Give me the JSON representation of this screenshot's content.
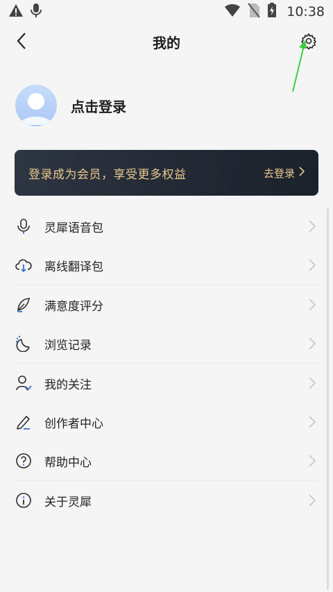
{
  "status_bar": {
    "time": "10:38",
    "icons": [
      "warning-icon",
      "mic-icon",
      "wifi-icon",
      "no-sim-icon",
      "battery-icon"
    ]
  },
  "header": {
    "title": "我的",
    "back_icon": "chevron-left-icon",
    "settings_icon": "gear-icon"
  },
  "profile": {
    "login_label": "点击登录"
  },
  "vip_banner": {
    "text": "登录成为会员，享受更多权益",
    "action": "去登录"
  },
  "menu": {
    "groups": [
      {
        "items": [
          {
            "label": "灵犀语音包",
            "icon": "microphone-icon"
          },
          {
            "label": "离线翻译包",
            "icon": "cloud-download-icon"
          }
        ]
      },
      {
        "items": [
          {
            "label": "满意度评分",
            "icon": "feather-icon"
          },
          {
            "label": "浏览记录",
            "icon": "history-icon"
          }
        ]
      },
      {
        "items": [
          {
            "label": "我的关注",
            "icon": "user-check-icon"
          },
          {
            "label": "创作者中心",
            "icon": "pen-icon"
          },
          {
            "label": "帮助中心",
            "icon": "help-icon"
          }
        ]
      },
      {
        "items": [
          {
            "label": "关于灵犀",
            "icon": "info-icon"
          }
        ]
      }
    ]
  },
  "colors": {
    "accent": "#3a6fd8",
    "vip_text": "#e9c98f",
    "banner_bg": "#242a35",
    "annotation_arrow": "#3ccf3c"
  }
}
